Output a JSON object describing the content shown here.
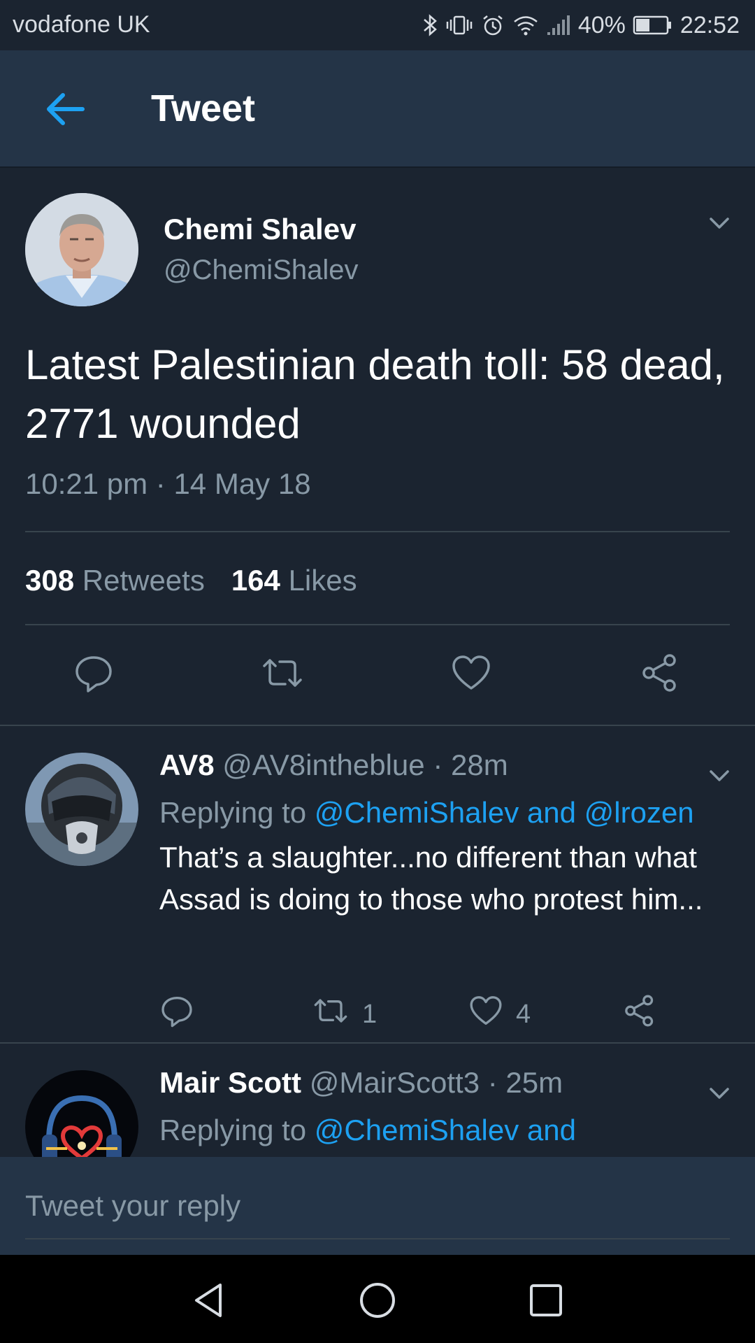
{
  "status_bar": {
    "carrier": "vodafone UK",
    "battery_percent": "40%",
    "time": "22:52",
    "icons": [
      "bluetooth-icon",
      "vibrate-icon",
      "alarm-icon",
      "wifi-icon",
      "signal-icon",
      "battery-icon"
    ]
  },
  "header": {
    "title": "Tweet",
    "back_icon": "back-arrow-icon"
  },
  "tweet": {
    "author_name": "Chemi Shalev",
    "author_handle": "@ChemiShalev",
    "text": "Latest Palestinian death toll: 58 dead, 2771 wounded",
    "timestamp": "10:21 pm · 14 May 18",
    "retweets_count": "308",
    "retweets_label": "Retweets",
    "likes_count": "164",
    "likes_label": "Likes",
    "actions": [
      "reply-icon",
      "retweet-icon",
      "like-icon",
      "share-icon"
    ]
  },
  "replies": [
    {
      "name": "AV8",
      "handle": "@AV8intheblue",
      "time": "· 28m",
      "replying_prefix": "Replying to",
      "replying_to": "@ChemiShalev and @lrozen",
      "text": "That’s a slaughter...no different than what Assad is doing to those who protest him...",
      "retweet_count": "1",
      "like_count": "4"
    },
    {
      "name": "Mair Scott",
      "handle": "@MairScott3",
      "time": "· 25m",
      "replying_prefix": "Replying to",
      "replying_to": "@ChemiShalev and"
    }
  ],
  "compose": {
    "placeholder": "Tweet your reply"
  },
  "colors": {
    "background": "#1b2430",
    "header": "#243447",
    "accent": "#1da1f2",
    "secondary_text": "#8899a6"
  }
}
